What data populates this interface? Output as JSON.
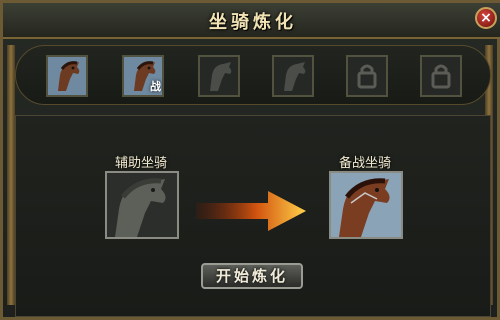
{
  "window": {
    "title": "坐骑炼化",
    "close_icon": "close-icon"
  },
  "mount_slots": [
    {
      "icon": "brown-horse-icon",
      "badge": ""
    },
    {
      "icon": "brown-horse-icon",
      "badge": "战"
    },
    {
      "icon": "horse-silhouette-icon",
      "badge": ""
    },
    {
      "icon": "horse-silhouette-icon",
      "badge": ""
    },
    {
      "icon": "locked-slot-icon",
      "badge": ""
    },
    {
      "icon": "locked-slot-icon",
      "badge": ""
    }
  ],
  "refine": {
    "auxiliary_label": "辅助坐骑",
    "battle_label": "备战坐骑",
    "start_button": "开始炼化"
  },
  "colors": {
    "accent": "#c9a251",
    "arrow": "#e8a21a",
    "text": "#f4ecd2"
  }
}
